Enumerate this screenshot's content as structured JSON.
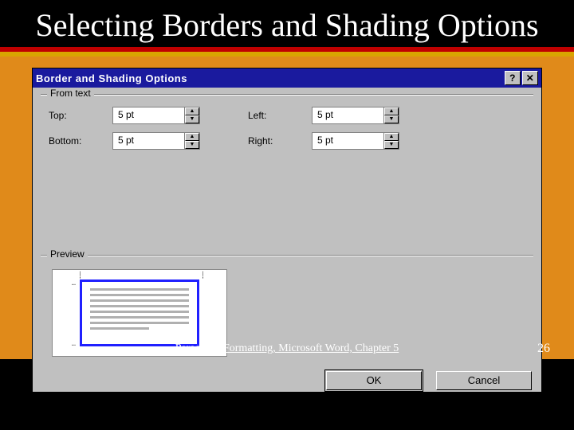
{
  "slide": {
    "title": "Selecting Borders and Shading Options",
    "footer_text": "Paragraph Formatting, Microsoft Word, Chapter 5",
    "page_number": "26"
  },
  "dialog": {
    "title": "Border and Shading Options",
    "help_glyph": "?",
    "close_glyph": "✕",
    "group_from_text": "From text",
    "group_preview": "Preview",
    "fields": {
      "top_label": "Top:",
      "top_value": "5 pt",
      "bottom_label": "Bottom:",
      "bottom_value": "5 pt",
      "left_label": "Left:",
      "left_value": "5 pt",
      "right_label": "Right:",
      "right_value": "5 pt"
    },
    "buttons": {
      "ok": "OK",
      "cancel": "Cancel"
    },
    "spin_up": "▲",
    "spin_down": "▼"
  }
}
